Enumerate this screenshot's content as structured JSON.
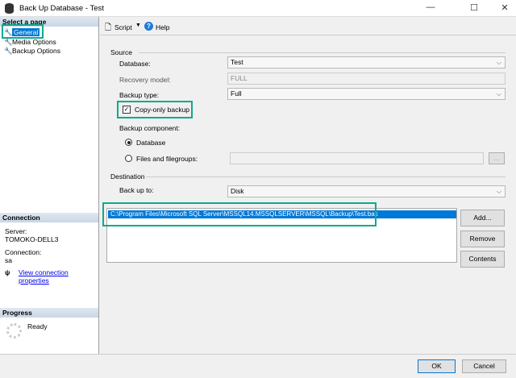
{
  "window": {
    "title": "Back Up Database - Test",
    "minimize": "—",
    "maximize": "☐",
    "close": "✕"
  },
  "sidebar": {
    "header": "Select a page",
    "items": [
      {
        "label": "General"
      },
      {
        "label": "Media Options"
      },
      {
        "label": "Backup Options"
      }
    ]
  },
  "connection": {
    "header": "Connection",
    "server_label": "Server:",
    "server": "TOMOKO-DELL3",
    "connection_label": "Connection:",
    "connection": "sa",
    "link": "View connection properties"
  },
  "progress": {
    "header": "Progress",
    "status": "Ready"
  },
  "toolbar": {
    "script": "Script",
    "help": "Help"
  },
  "source": {
    "label": "Source",
    "database_label": "Database:",
    "database": "Test",
    "recovery_label": "Recovery model:",
    "recovery": "FULL",
    "backup_type_label": "Backup type:",
    "backup_type": "Full",
    "copy_only_label": "Copy-only backup",
    "copy_only": true,
    "component_label": "Backup component:",
    "component_database": "Database",
    "component_files": "Files and filegroups:",
    "selected_component": "Database",
    "files_button": "..."
  },
  "destination": {
    "label": "Destination",
    "backup_to_label": "Back up to:",
    "backup_to": "Disk",
    "paths": [
      "C:\\Program Files\\Microsoft SQL Server\\MSSQL14.MSSQLSERVER\\MSSQL\\Backup\\Test.bak"
    ],
    "add": "Add...",
    "remove": "Remove",
    "contents": "Contents"
  },
  "footer": {
    "ok": "OK",
    "cancel": "Cancel"
  },
  "colors": {
    "highlight": "#10a98b",
    "selection": "#0078d7"
  }
}
